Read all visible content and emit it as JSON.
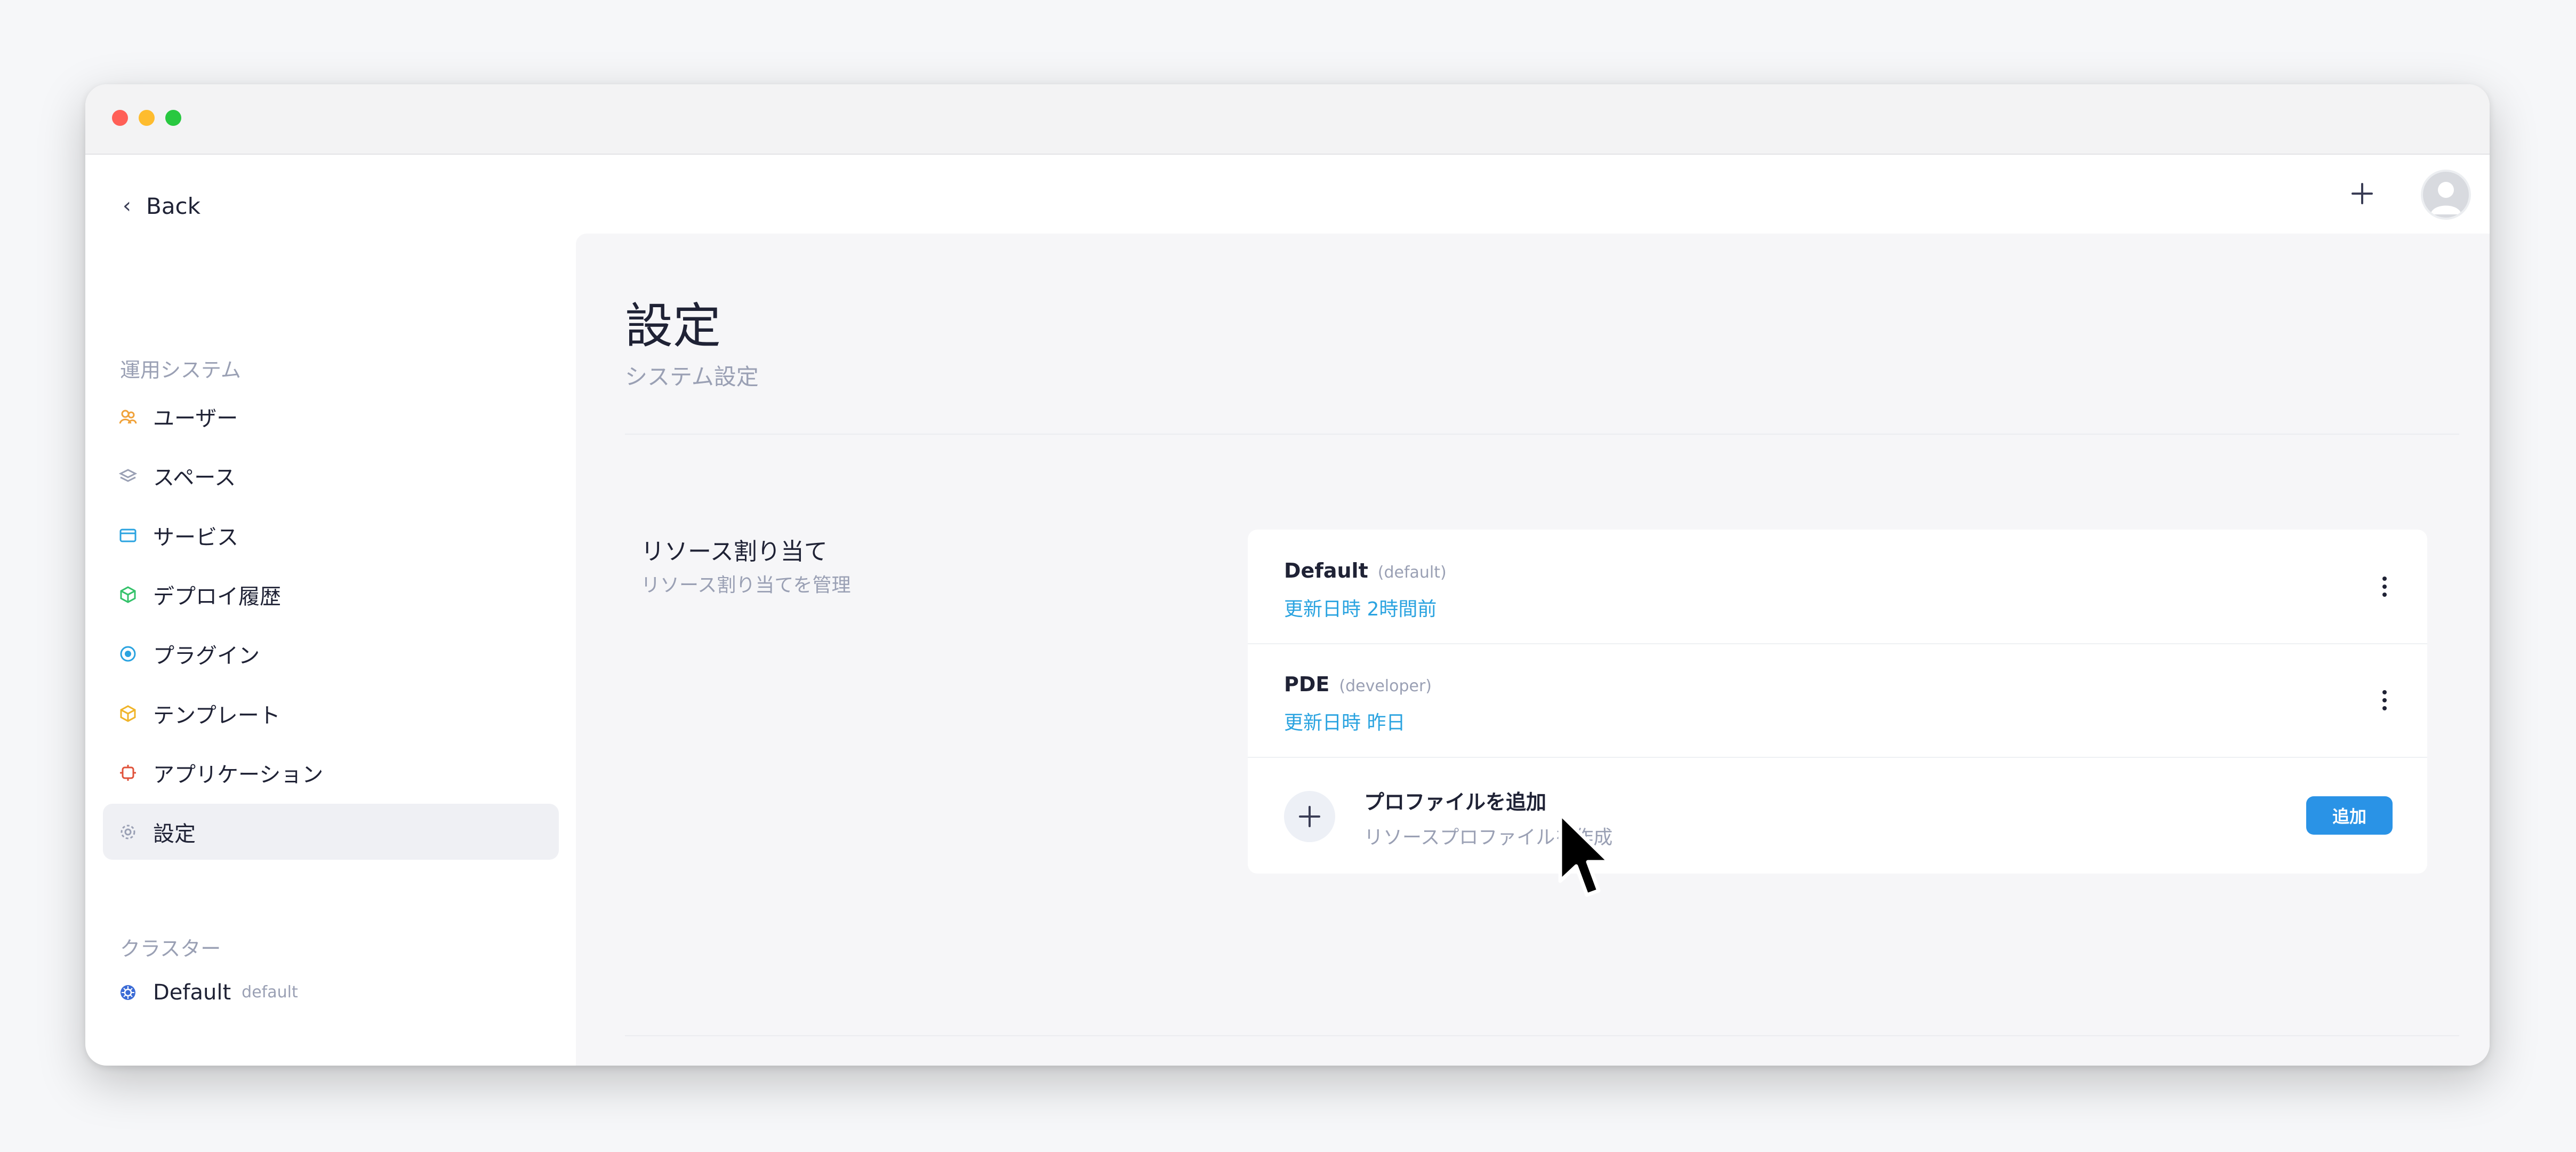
{
  "window": {
    "controls": [
      "close",
      "minimize",
      "zoom"
    ]
  },
  "header": {
    "back_label": "Back",
    "add_icon": "plus-icon",
    "avatar_icon": "user-avatar"
  },
  "sidebar": {
    "section_title": "運用システム",
    "items": [
      {
        "label": "ユーザー",
        "icon": "users-icon",
        "color": "#f0a23a"
      },
      {
        "label": "スペース",
        "icon": "layers-icon",
        "color": "#9aa0b4"
      },
      {
        "label": "サービス",
        "icon": "window-icon",
        "color": "#2aa3e0"
      },
      {
        "label": "デプロイ履歴",
        "icon": "cube-icon",
        "color": "#34c26a"
      },
      {
        "label": "プラグイン",
        "icon": "plugin-icon",
        "color": "#2aa3e0"
      },
      {
        "label": "テンプレート",
        "icon": "box-icon",
        "color": "#f0b429"
      },
      {
        "label": "アプリケーション",
        "icon": "app-icon",
        "color": "#e0523a"
      },
      {
        "label": "設定",
        "icon": "gear-icon",
        "color": "#9aa0b4",
        "active": true
      }
    ],
    "cluster_title": "クラスター",
    "cluster": {
      "label": "Default",
      "sub": "default",
      "icon": "kubernetes-icon",
      "color": "#3b6bd6"
    }
  },
  "main": {
    "title": "設定",
    "subtitle": "システム設定",
    "section": {
      "title": "リソース割り当て",
      "description": "リソース割り当てを管理"
    },
    "profiles": [
      {
        "name": "Default",
        "tag": "(default)",
        "updated": "更新日時 2時間前"
      },
      {
        "name": "PDE",
        "tag": "(developer)",
        "updated": "更新日時 昨日"
      }
    ],
    "add_profile": {
      "title": "プロファイルを追加",
      "description": "リソースプロファイルを作成",
      "button_label": "追加"
    }
  },
  "colors": {
    "accent": "#2a93e6",
    "link": "#2aa3e0"
  }
}
